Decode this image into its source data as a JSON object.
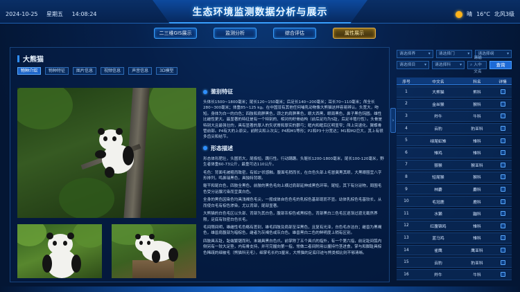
{
  "header": {
    "date": "2024-10-25",
    "weekday": "星期五",
    "time": "14:08:24",
    "title": "生态环境监测数据分析与展示",
    "weather": {
      "icon": "sun-icon",
      "condition": "晴",
      "temperature": "16°C",
      "wind": "北风3级"
    }
  },
  "nav": [
    {
      "label": "二三维GIS展示",
      "active": false
    },
    {
      "label": "监测分析",
      "active": false
    },
    {
      "label": "综合评估",
      "active": false
    },
    {
      "label": "属性展示",
      "active": true
    }
  ],
  "main": {
    "title": "大熊猫",
    "tabs": [
      {
        "label": "物种介绍",
        "active": true
      },
      {
        "label": "物种特征",
        "active": false
      },
      {
        "label": "图片信息",
        "active": false
      },
      {
        "label": "视频信息",
        "active": false
      },
      {
        "label": "声音信息",
        "active": false
      },
      {
        "label": "3D模型",
        "active": false
      }
    ],
    "features_heading": "鉴别特征",
    "features_text": "头体长1500~1800毫米；尾长120~150毫米；后足长140~200毫米；耳长70~110毫米；颅全长280~300毫米；体重85~125 kg。在中国没有其他任何哺乳动物像大熊猫这样容易辨认。头宽大，吻短。身体为白一的白色；四肢和肩胛黑色，颈之的肩胛黑色，眼大西黑，眼周黑色，鼻子黑色钝圆。雄性比雌性更大。最显著的特征是有一个特别的、相对的籽骨结构（前后足均为5趾，后足半殖行性）。头骨是特别大且最强壮的，具有显著的厚人的矢状脊和厚实的颧弓；眶内和眶后区明显窄；颅上突退化。翼蝶骨管前部。P4有大的上原尖，前附尖和上次尖；P4和M1等形；P2和P3十分宽达；M1和M2巨大，其上有很多齿尖和结节。",
    "morph_heading": "形态描述",
    "morph_text": [
      "形态体形肥壮，头圆而大，尾极短。蹒行性。行动蹒跚。头躯长1200-1800毫米，尾长100-120毫米，野生者体重60-73公斤，最重可达110公斤。",
      "毛色：背面毛被粗而致密，有如2¹状感触。腹面毛稍而长，在白色头部上毛冒冀黑其眼，大黑眼圈呈八字形排列，鸣鼻瑞黑色，具独特背眼。",
      "躯干和尾白色，四肢全黑色，前肢的黑色毛向上横过肩部延伸成黑色环带。尾短，其下有分泌物，周围毛色受分泌腺污染而呈黄白色。",
      "全身的黑色因染色均具浅褐色毛尖，一般成体自色色毛的乳棕色基部现而不显。幼体乳棕色毛基较长，从而使白毛有棕色渗染，尤以背部，尾部显著。",
      "大熊猫的白色毛区以头部、背部为其白色，腹部灰棕色或黑棕色，背部黑白二色毛区逐渐过渡无截然界限，足底有较密白色长毛。",
      "毛间限间明，雄雌性毛色略有差别，雄毛四肢及肩部至深黑色，且复有光泽，白色毛亦洁白；雌兽为黑褐色，雄兽肩腹部为暗棕色，雌者为灰褐色或灰白色。雄兽黑白二色的鲜明度上稍有区别。",
      "四肢具五趾，趾端繁锯而利，末端具黑白色爪。前掌除了五个具爪的指外，有一个第六指，前足趾间弧内侧另有一较大足垫，内有骨支持，并可完握向第一指，常做二者间附用以握持竹茎进食。掌与和脚趾具棕色稀疏的细被毛（熊猫科无毛），细掌毛长约3厘米，大熊猫的足底印迹与熊类相比则不够清晰。"
    ]
  },
  "filters": {
    "genus": "请选择界",
    "phylum": "请选择门",
    "kingdom": "请选择纲",
    "order": "请选择目",
    "family": "请选择科",
    "search_placeholder": "请输入中文名",
    "query_label": "查询"
  },
  "table": {
    "headers": [
      "序号",
      "中文名",
      "科名",
      "详情"
    ],
    "rows": [
      {
        "no": "1",
        "name": "大熊猫",
        "family": "熊科"
      },
      {
        "no": "2",
        "name": "金丝猴",
        "family": "猴科"
      },
      {
        "no": "3",
        "name": "羚牛",
        "family": "牛科"
      },
      {
        "no": "4",
        "name": "云豹",
        "family": "豹亚科"
      },
      {
        "no": "5",
        "name": "绿尾虹雉",
        "family": "雉科"
      },
      {
        "no": "6",
        "name": "雉鸡",
        "family": "雉科"
      },
      {
        "no": "7",
        "name": "猕猴",
        "family": "猴亚科"
      },
      {
        "no": "8",
        "name": "短尾猴",
        "family": "猴科"
      },
      {
        "no": "9",
        "name": "林麝",
        "family": "麝科"
      },
      {
        "no": "10",
        "name": "毛冠鹿",
        "family": "鹿科"
      },
      {
        "no": "11",
        "name": "水獭",
        "family": "鼬科"
      },
      {
        "no": "12",
        "name": "红腹锦鸡",
        "family": "雉科"
      },
      {
        "no": "13",
        "name": "蓝马鸡",
        "family": "雉科"
      },
      {
        "no": "14",
        "name": "雀鹰",
        "family": "鹰亚科"
      },
      {
        "no": "15",
        "name": "云豹",
        "family": "豹亚科"
      },
      {
        "no": "16",
        "name": "羚牛",
        "family": "牛科"
      }
    ]
  }
}
